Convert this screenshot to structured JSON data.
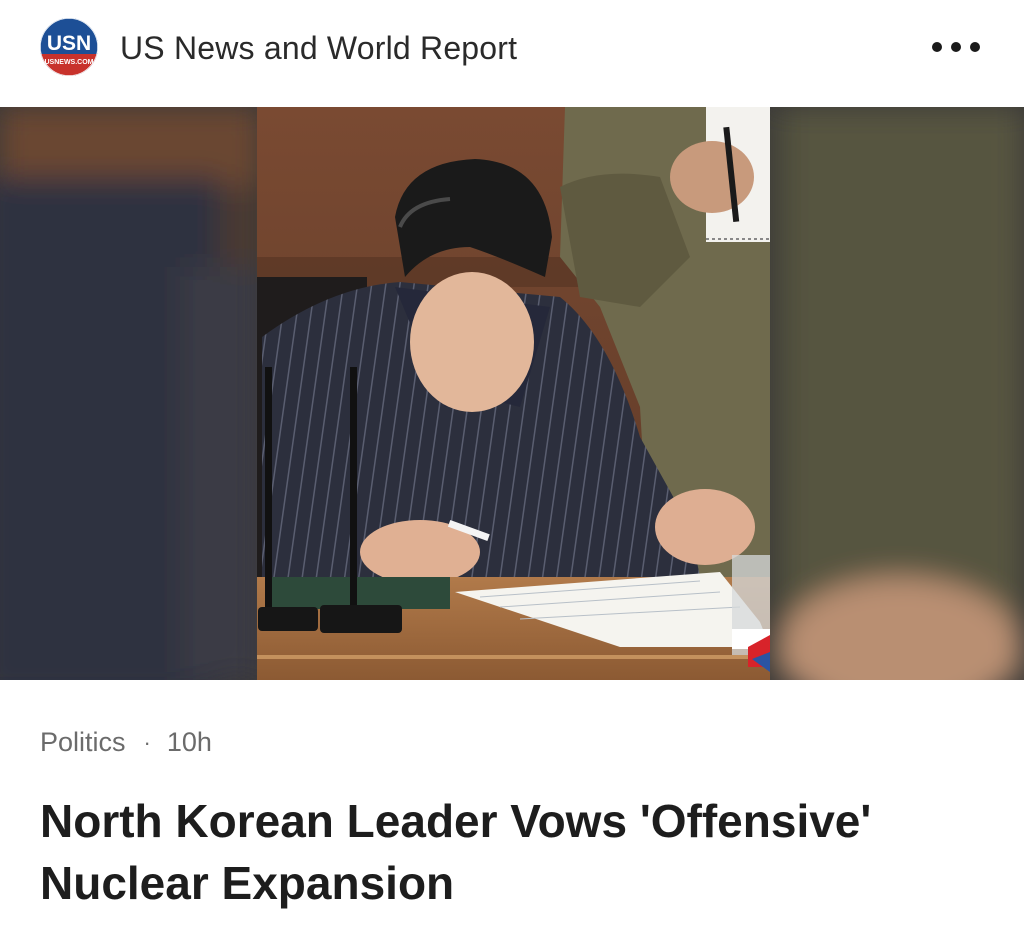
{
  "header": {
    "logo_text": "USN",
    "logo_subtext": "USNEWS.COM",
    "source_name": "US News and World Report",
    "more_icon": "more-horizontal-icon"
  },
  "article": {
    "category": "Politics",
    "separator": "·",
    "time_ago": "10h",
    "headline": "North Korean Leader Vows 'Offensive' Nuclear Expansion"
  },
  "colors": {
    "logo_blue": "#1d4f96",
    "logo_red": "#c8322c",
    "text_primary": "#1d1d1d",
    "text_secondary": "#6b6b6b"
  }
}
